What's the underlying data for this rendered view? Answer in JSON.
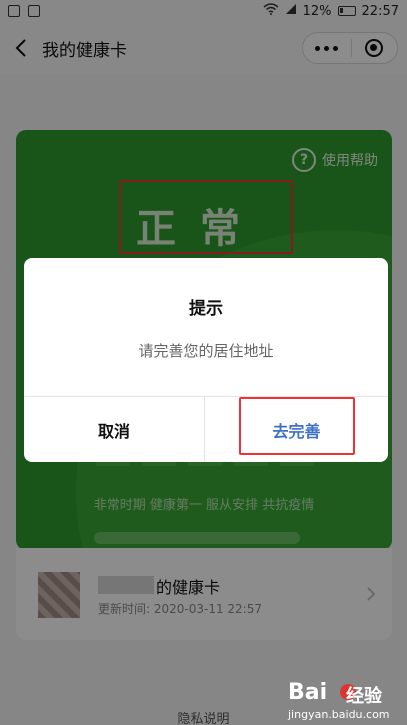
{
  "status_bar": {
    "battery": "12%",
    "time": "22:57"
  },
  "nav": {
    "title": "我的健康卡"
  },
  "card": {
    "help_label": "使用帮助",
    "help_icon": "question-circle-icon",
    "status": "正常",
    "slogan": "非常时期 健康第一 服从安排 共抗疫情"
  },
  "user": {
    "card_name": "的健康卡",
    "update_time": "更新时间: 2020-03-11 22:57"
  },
  "footer": {
    "privacy": "隐私说明"
  },
  "dialog": {
    "title": "提示",
    "message": "请完善您的居住地址",
    "cancel_label": "取消",
    "confirm_label": "去完善"
  },
  "watermark": {
    "brand": "Bai",
    "sub": "经验",
    "url": "jingyan.baidu.com"
  },
  "colors": {
    "card_green": "#2f9a2c",
    "confirm_blue": "#3d70c8",
    "highlight_red": "#e33333"
  }
}
